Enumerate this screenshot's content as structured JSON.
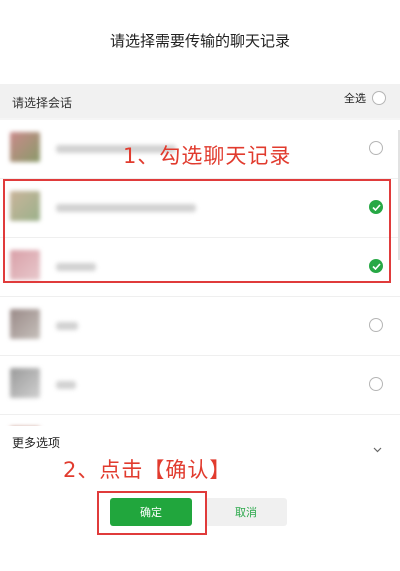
{
  "dialog": {
    "title": "请选择需要传输的聊天记录"
  },
  "list_header": {
    "label": "请选择会话",
    "select_all_label": "全选",
    "select_all_checked": false
  },
  "chats": [
    {
      "avatar_color": "#c98a8a",
      "avatar_color_2": "#8a9a6a",
      "checked": false
    },
    {
      "avatar_color": "#c9b49a",
      "avatar_color_2": "#9bb18b",
      "checked": true
    },
    {
      "avatar_color": "#d9a0a8",
      "avatar_color_2": "#e8c8cc",
      "checked": true
    },
    {
      "avatar_color": "#9a8a88",
      "avatar_color_2": "#c6c0bb",
      "checked": false
    },
    {
      "avatar_color": "#9a9a9a",
      "avatar_color_2": "#d0d0d0",
      "checked": false
    },
    {
      "avatar_color": "#b07060",
      "avatar_color_2": "#c9a090",
      "checked": false
    }
  ],
  "more_options": {
    "label": "更多选项"
  },
  "buttons": {
    "confirm_label": "确定",
    "cancel_label": "取消"
  },
  "annotations": {
    "step1": "1、勾选聊天记录",
    "step2": "2、点击【确认】"
  },
  "colors": {
    "accent_green": "#21a63d",
    "annotation_red": "#e03b3b"
  }
}
